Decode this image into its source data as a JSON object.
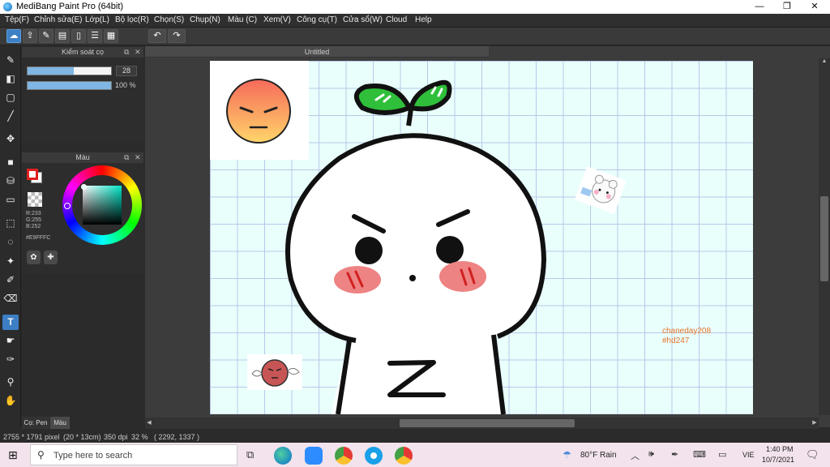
{
  "window": {
    "title": "MediBang Paint Pro (64bit)",
    "min": "—",
    "max": "❐",
    "close": "✕"
  },
  "menu": [
    "Tệp(F)",
    "Chỉnh sửa(E)",
    "Lớp(L)",
    "Bộ lọc(R)",
    "Chọn(S)",
    "Chụp(N)",
    "Màu (C)",
    "Xem(V)",
    "Công cụ(T)",
    "Cửa sổ(W)",
    "Cloud",
    "Help"
  ],
  "toolbar": {
    "undo_icon": "undo-icon",
    "redo_icon": "redo-icon"
  },
  "brush_panel": {
    "title": "Kiểm soát cọ",
    "size_value": "28",
    "opacity_value": "100 %",
    "size_fraction": 0.55,
    "opacity_fraction": 1.0
  },
  "color_panel": {
    "title": "Màu",
    "r": "R:233",
    "g": "G:255",
    "b": "B:252",
    "hex": "#E9FFFC",
    "fg_color": "#e02020",
    "bg_color": "#ffffff"
  },
  "panel_tabs": [
    "Cọ: Pen",
    "Màu"
  ],
  "document": {
    "tab_title": "Untitled",
    "paper_color": "#e9fffc"
  },
  "canvas_text": {
    "line1": "chaneday208",
    "line2": "#hd247",
    "z_letter": "Z"
  },
  "status": {
    "size": "2755 * 1791 pixel",
    "dims": "(20 * 13cm)",
    "dpi": "350 dpi",
    "zoom": "32 %",
    "coords": "( 2292, 1337 )"
  },
  "taskbar": {
    "search_placeholder": "Type here to search",
    "weather": "80°F  Rain",
    "lang": "VIE",
    "time": "1:40 PM",
    "date": "10/7/2021"
  }
}
